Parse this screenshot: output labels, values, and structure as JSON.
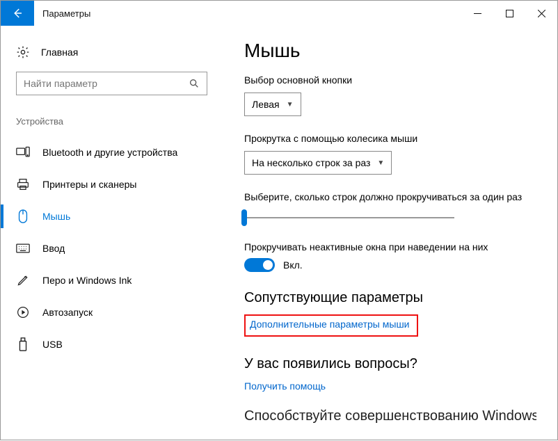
{
  "window": {
    "title": "Параметры"
  },
  "sidebar": {
    "home": "Главная",
    "search_placeholder": "Найти параметр",
    "section": "Устройства",
    "items": [
      {
        "label": "Bluetooth и другие устройства"
      },
      {
        "label": "Принтеры и сканеры"
      },
      {
        "label": "Мышь"
      },
      {
        "label": "Ввод"
      },
      {
        "label": "Перо и Windows Ink"
      },
      {
        "label": "Автозапуск"
      },
      {
        "label": "USB"
      }
    ]
  },
  "content": {
    "heading": "Мышь",
    "primary_button_label": "Выбор основной кнопки",
    "primary_button_value": "Левая",
    "scroll_label": "Прокрутка с помощью колесика мыши",
    "scroll_value": "На несколько строк за раз",
    "lines_label": "Выберите, сколько строк должно прокручиваться за один раз",
    "inactive_label": "Прокручивать неактивные окна при наведении на них",
    "toggle_on": "Вкл.",
    "related_heading": "Сопутствующие параметры",
    "related_link": "Дополнительные параметры мыши",
    "question_heading": "У вас появились вопросы?",
    "help_link": "Получить помощь",
    "cutoff_heading": "Способствуйте совершенствованию Windows"
  }
}
